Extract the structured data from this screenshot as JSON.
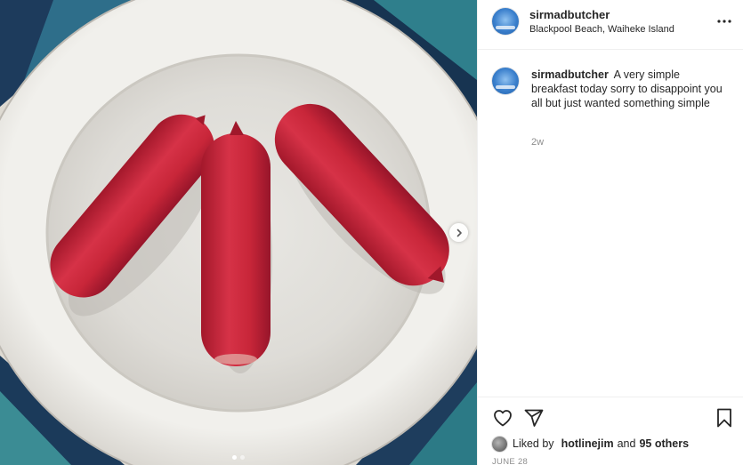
{
  "post": {
    "username": "sirmadbutcher",
    "location": "Blackpool Beach, Waiheke Island",
    "caption": "A very simple breakfast today sorry to disappoint you all but just wanted something simple",
    "time_ago": "2w",
    "liked_by_prefix": "Liked by",
    "liked_by_user": "hotlinejim",
    "liked_by_joiner": "and",
    "likes_others": "95 others",
    "date": "JUNE 28"
  },
  "carousel": {
    "current": 1,
    "total": 2
  },
  "icons": {
    "more": "more-options-icon",
    "next": "chevron-right-icon",
    "like": "heart-icon",
    "share": "paper-plane-icon",
    "save": "bookmark-icon"
  },
  "colors": {
    "sausage": "#c7263a",
    "plate": "#ecebe7",
    "text": "#262626",
    "muted": "#8e8e8e"
  }
}
